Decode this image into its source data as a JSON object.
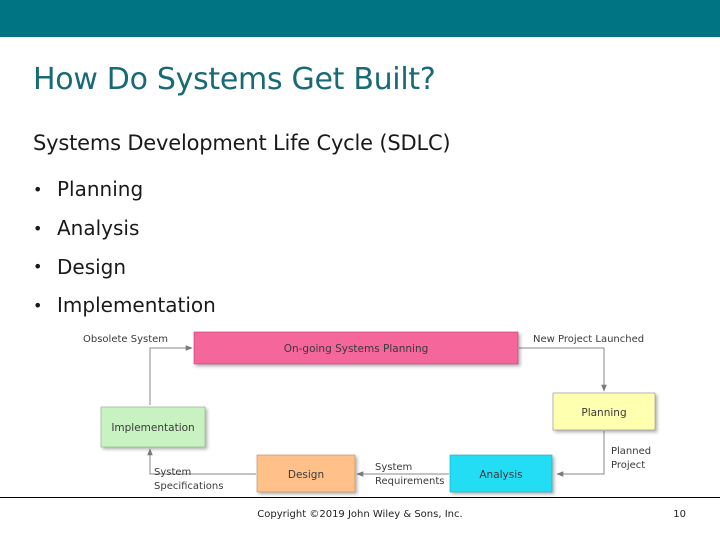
{
  "slide": {
    "title": "How Do Systems Get Built?",
    "subtitle": "Systems Development Life Cycle (SDLC)",
    "bullets": [
      "Planning",
      "Analysis",
      "Design",
      "Implementation"
    ],
    "bullet_char": "•",
    "copyright": "Copyright ©2019 John Wiley & Sons, Inc.",
    "page_number": "10",
    "accent_color": "#007482"
  },
  "diagram": {
    "boxes": {
      "ongoing": "On-going Systems Planning",
      "planning": "Planning",
      "analysis": "Analysis",
      "design": "Design",
      "implementation": "Implementation"
    },
    "labels": {
      "obsolete": "Obsolete System",
      "new_project": "New Project Launched",
      "planned_project": [
        "Planned",
        "Project"
      ],
      "system_requirements": [
        "System",
        "Requirements"
      ],
      "system_specifications": [
        "System",
        "Specifications"
      ]
    },
    "colors": {
      "ongoing": "#f5669a",
      "planning": "#ffffb0",
      "analysis": "#22ddf4",
      "design": "#ffc08a",
      "implementation": "#c8f2c2"
    }
  }
}
